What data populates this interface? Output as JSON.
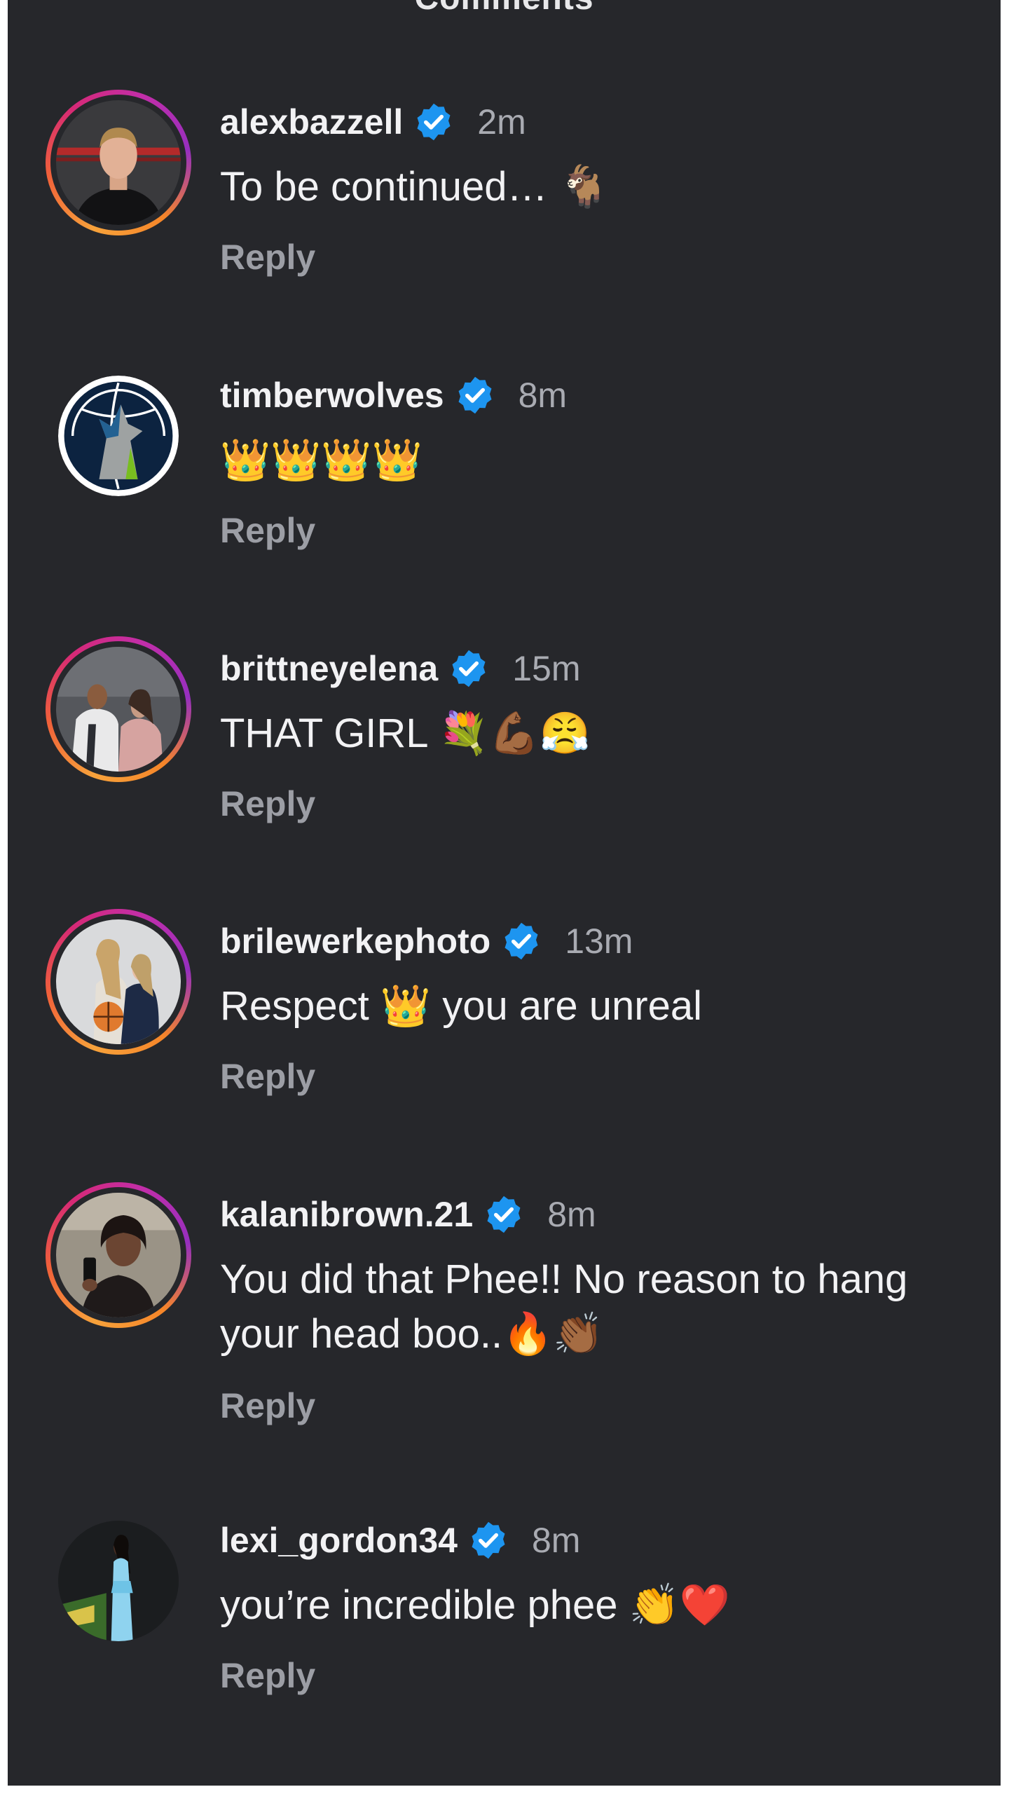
{
  "header": {
    "title": "Comments"
  },
  "colors": {
    "background": "#26272b",
    "verified_badge": "#1d95f0",
    "text_primary": "#f2f2f4",
    "text_secondary": "#9c9ea5",
    "story_ring": [
      "#f7a23b",
      "#d62976",
      "#962fbf"
    ]
  },
  "comments": [
    {
      "username": "alexbazzell",
      "verified": true,
      "time": "2m",
      "text": "To be continued… 🐐",
      "reply_label": "Reply",
      "avatar_icon": "man-portrait-avatar"
    },
    {
      "username": "timberwolves",
      "verified": true,
      "time": "8m",
      "text": "👑👑👑👑",
      "reply_label": "Reply",
      "avatar_icon": "timberwolves-logo-avatar"
    },
    {
      "username": "brittneyelena",
      "verified": true,
      "time": "15m",
      "text": "THAT GIRL 💐💪🏾😤",
      "reply_label": "Reply",
      "avatar_icon": "couple-photo-avatar"
    },
    {
      "username": "brilewerkephoto",
      "verified": true,
      "time": "13m",
      "text": "Respect 👑 you are unreal",
      "reply_label": "Reply",
      "avatar_icon": "basketball-players-avatar"
    },
    {
      "username": "kalanibrown.21",
      "verified": true,
      "time": "8m",
      "text": "You did that Phee!! No reason to hang your head boo..🔥👏🏾",
      "reply_label": "Reply",
      "avatar_icon": "woman-selfie-avatar"
    },
    {
      "username": "lexi_gordon34",
      "verified": true,
      "time": "8m",
      "text": "you’re incredible phee 👏❤️",
      "reply_label": "Reply",
      "avatar_icon": "woman-blue-dress-avatar"
    }
  ]
}
